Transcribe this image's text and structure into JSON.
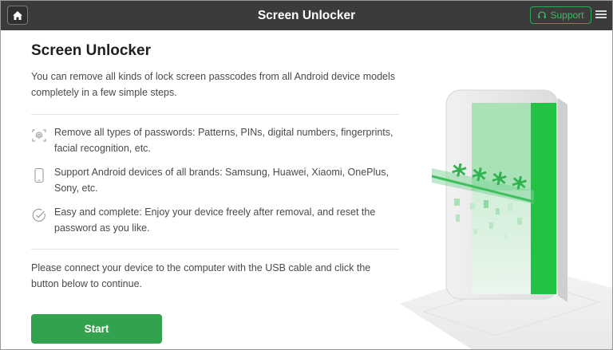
{
  "app": {
    "title": "Screen Unlocker",
    "support_label": "Support"
  },
  "main": {
    "heading": "Screen Unlocker",
    "intro": "You can remove all kinds of lock screen passcodes from all Android device models completely in a few simple steps.",
    "features": [
      {
        "icon": "fingerprint-icon",
        "text": "Remove all types of passwords: Patterns, PINs, digital numbers, fingerprints, facial recognition, etc."
      },
      {
        "icon": "phone-icon",
        "text": "Support Android devices of all brands: Samsung, Huawei, Xiaomi, OnePlus, Sony, etc."
      },
      {
        "icon": "check-circle-icon",
        "text": "Easy and complete: Enjoy your device freely after removal, and reset the password as you like."
      }
    ],
    "connect_text": "Please connect your device to the computer with the USB cable and click the button below to continue.",
    "start_label": "Start"
  },
  "illustration": {
    "password_mask": "****"
  },
  "colors": {
    "titlebar": "#3b3b3b",
    "accent": "#33a24f",
    "support_border": "#2fa853"
  }
}
